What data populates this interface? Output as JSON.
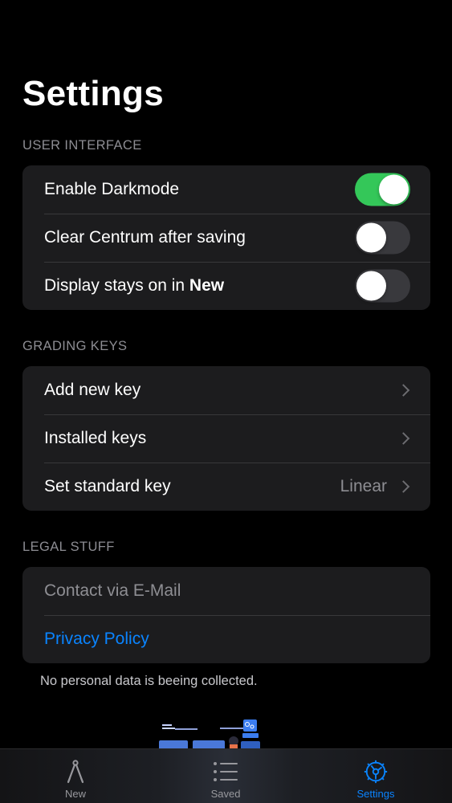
{
  "page": {
    "title": "Settings"
  },
  "sections": {
    "ui": {
      "header": "USER INTERFACE",
      "darkmode": {
        "label": "Enable Darkmode",
        "enabled": true
      },
      "clear_centrum": {
        "label": "Clear Centrum after saving",
        "enabled": false
      },
      "display_on": {
        "label_prefix": "Display stays on in ",
        "label_bold": "New",
        "enabled": false
      }
    },
    "grading": {
      "header": "GRADING KEYS",
      "add_key": {
        "label": "Add new key"
      },
      "installed_keys": {
        "label": "Installed keys"
      },
      "standard_key": {
        "label": "Set standard key",
        "value": "Linear"
      }
    },
    "legal": {
      "header": "LEGAL STUFF",
      "contact": {
        "label": "Contact via E-Mail"
      },
      "privacy": {
        "label": "Privacy Policy"
      },
      "note": "No personal data is beeing collected."
    }
  },
  "tabbar": {
    "tabs": [
      {
        "label": "New",
        "icon": "compass-icon",
        "active": false
      },
      {
        "label": "Saved",
        "icon": "list-icon",
        "active": false
      },
      {
        "label": "Settings",
        "icon": "gear-icon",
        "active": true
      }
    ]
  },
  "colors": {
    "accent": "#0a84ff",
    "toggle_on": "#34c759",
    "background": "#000000",
    "group_bg": "#1c1c1e"
  }
}
